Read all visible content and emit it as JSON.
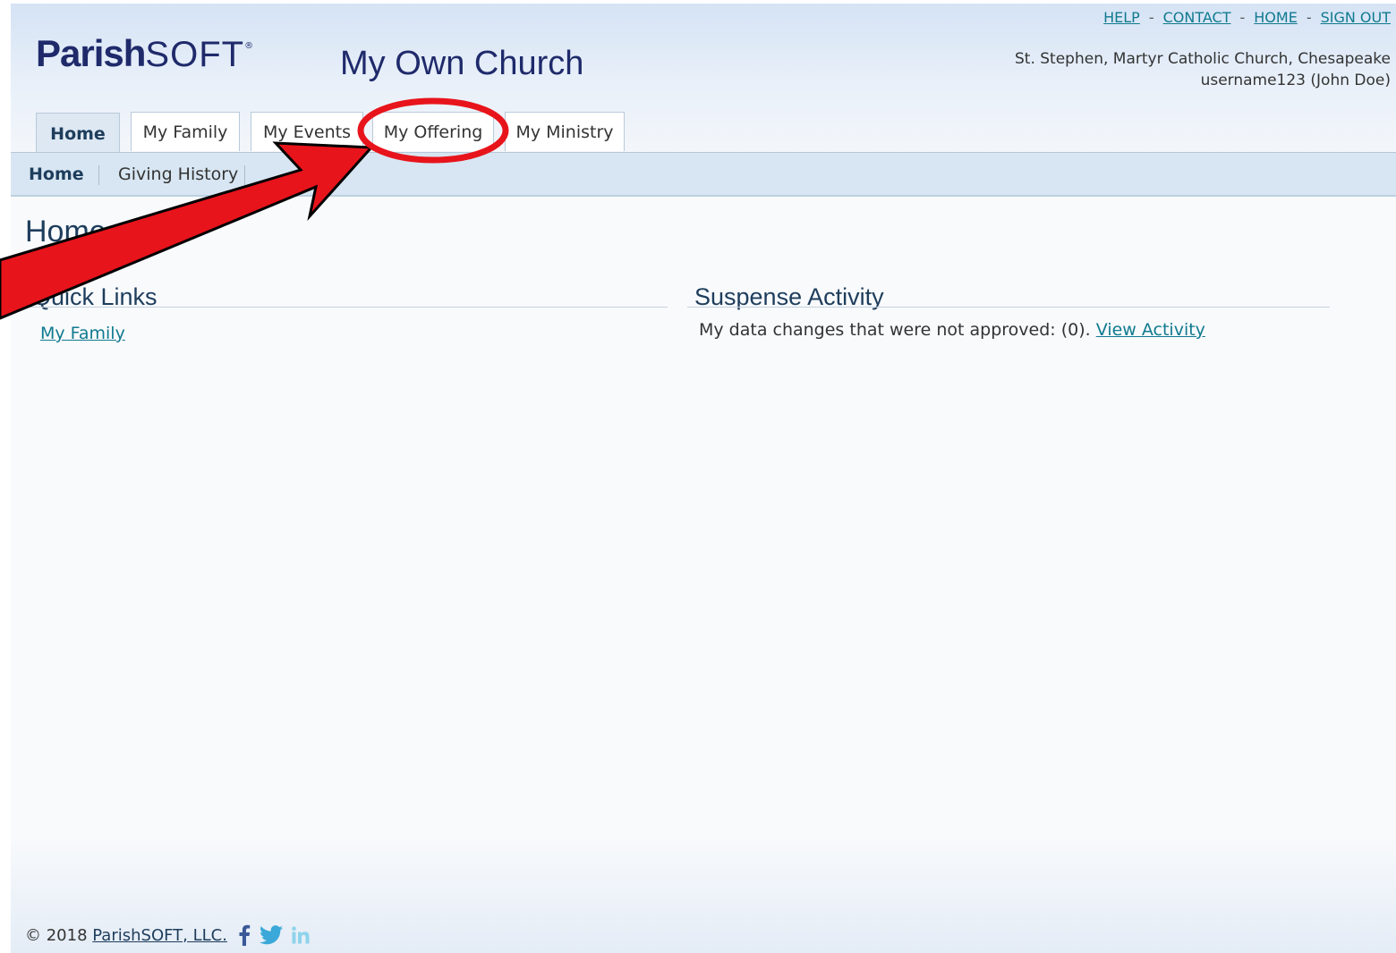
{
  "header": {
    "logo_word1": "Parish",
    "logo_word2": "SOFT",
    "logo_reg": "®",
    "church_name": "My Own Church",
    "top_links": [
      "HELP",
      "CONTACT",
      "HOME",
      "SIGN OUT"
    ],
    "separator": "-",
    "org_line": "St. Stephen, Martyr Catholic Church, Chesapeake",
    "user_line": "username123 (John Doe)"
  },
  "tabs": [
    {
      "label": "Home",
      "active": true
    },
    {
      "label": "My Family",
      "active": false
    },
    {
      "label": "My Events",
      "active": false
    },
    {
      "label": "My Offering",
      "active": false
    },
    {
      "label": "My Ministry",
      "active": false
    }
  ],
  "subnav": [
    {
      "label": "Home",
      "active": true
    },
    {
      "label": "Giving History",
      "active": false
    }
  ],
  "main": {
    "page_title": "Home",
    "quick_links": {
      "title": "Quick Links",
      "links": [
        "My Family"
      ]
    },
    "suspense": {
      "title": "Suspense Activity",
      "text": "My data changes that were not approved: (0).",
      "link": "View Activity"
    }
  },
  "footer": {
    "copyright": "© 2018",
    "company_link": "ParishSOFT, LLC.",
    "social_icons": [
      "facebook-icon",
      "twitter-icon",
      "linkedin-icon"
    ]
  },
  "colors": {
    "brand_navy": "#1f2a6b",
    "link_teal": "#107a8f",
    "annotation_red": "#e8141b",
    "subnav_bg": "#d7e6f2"
  }
}
